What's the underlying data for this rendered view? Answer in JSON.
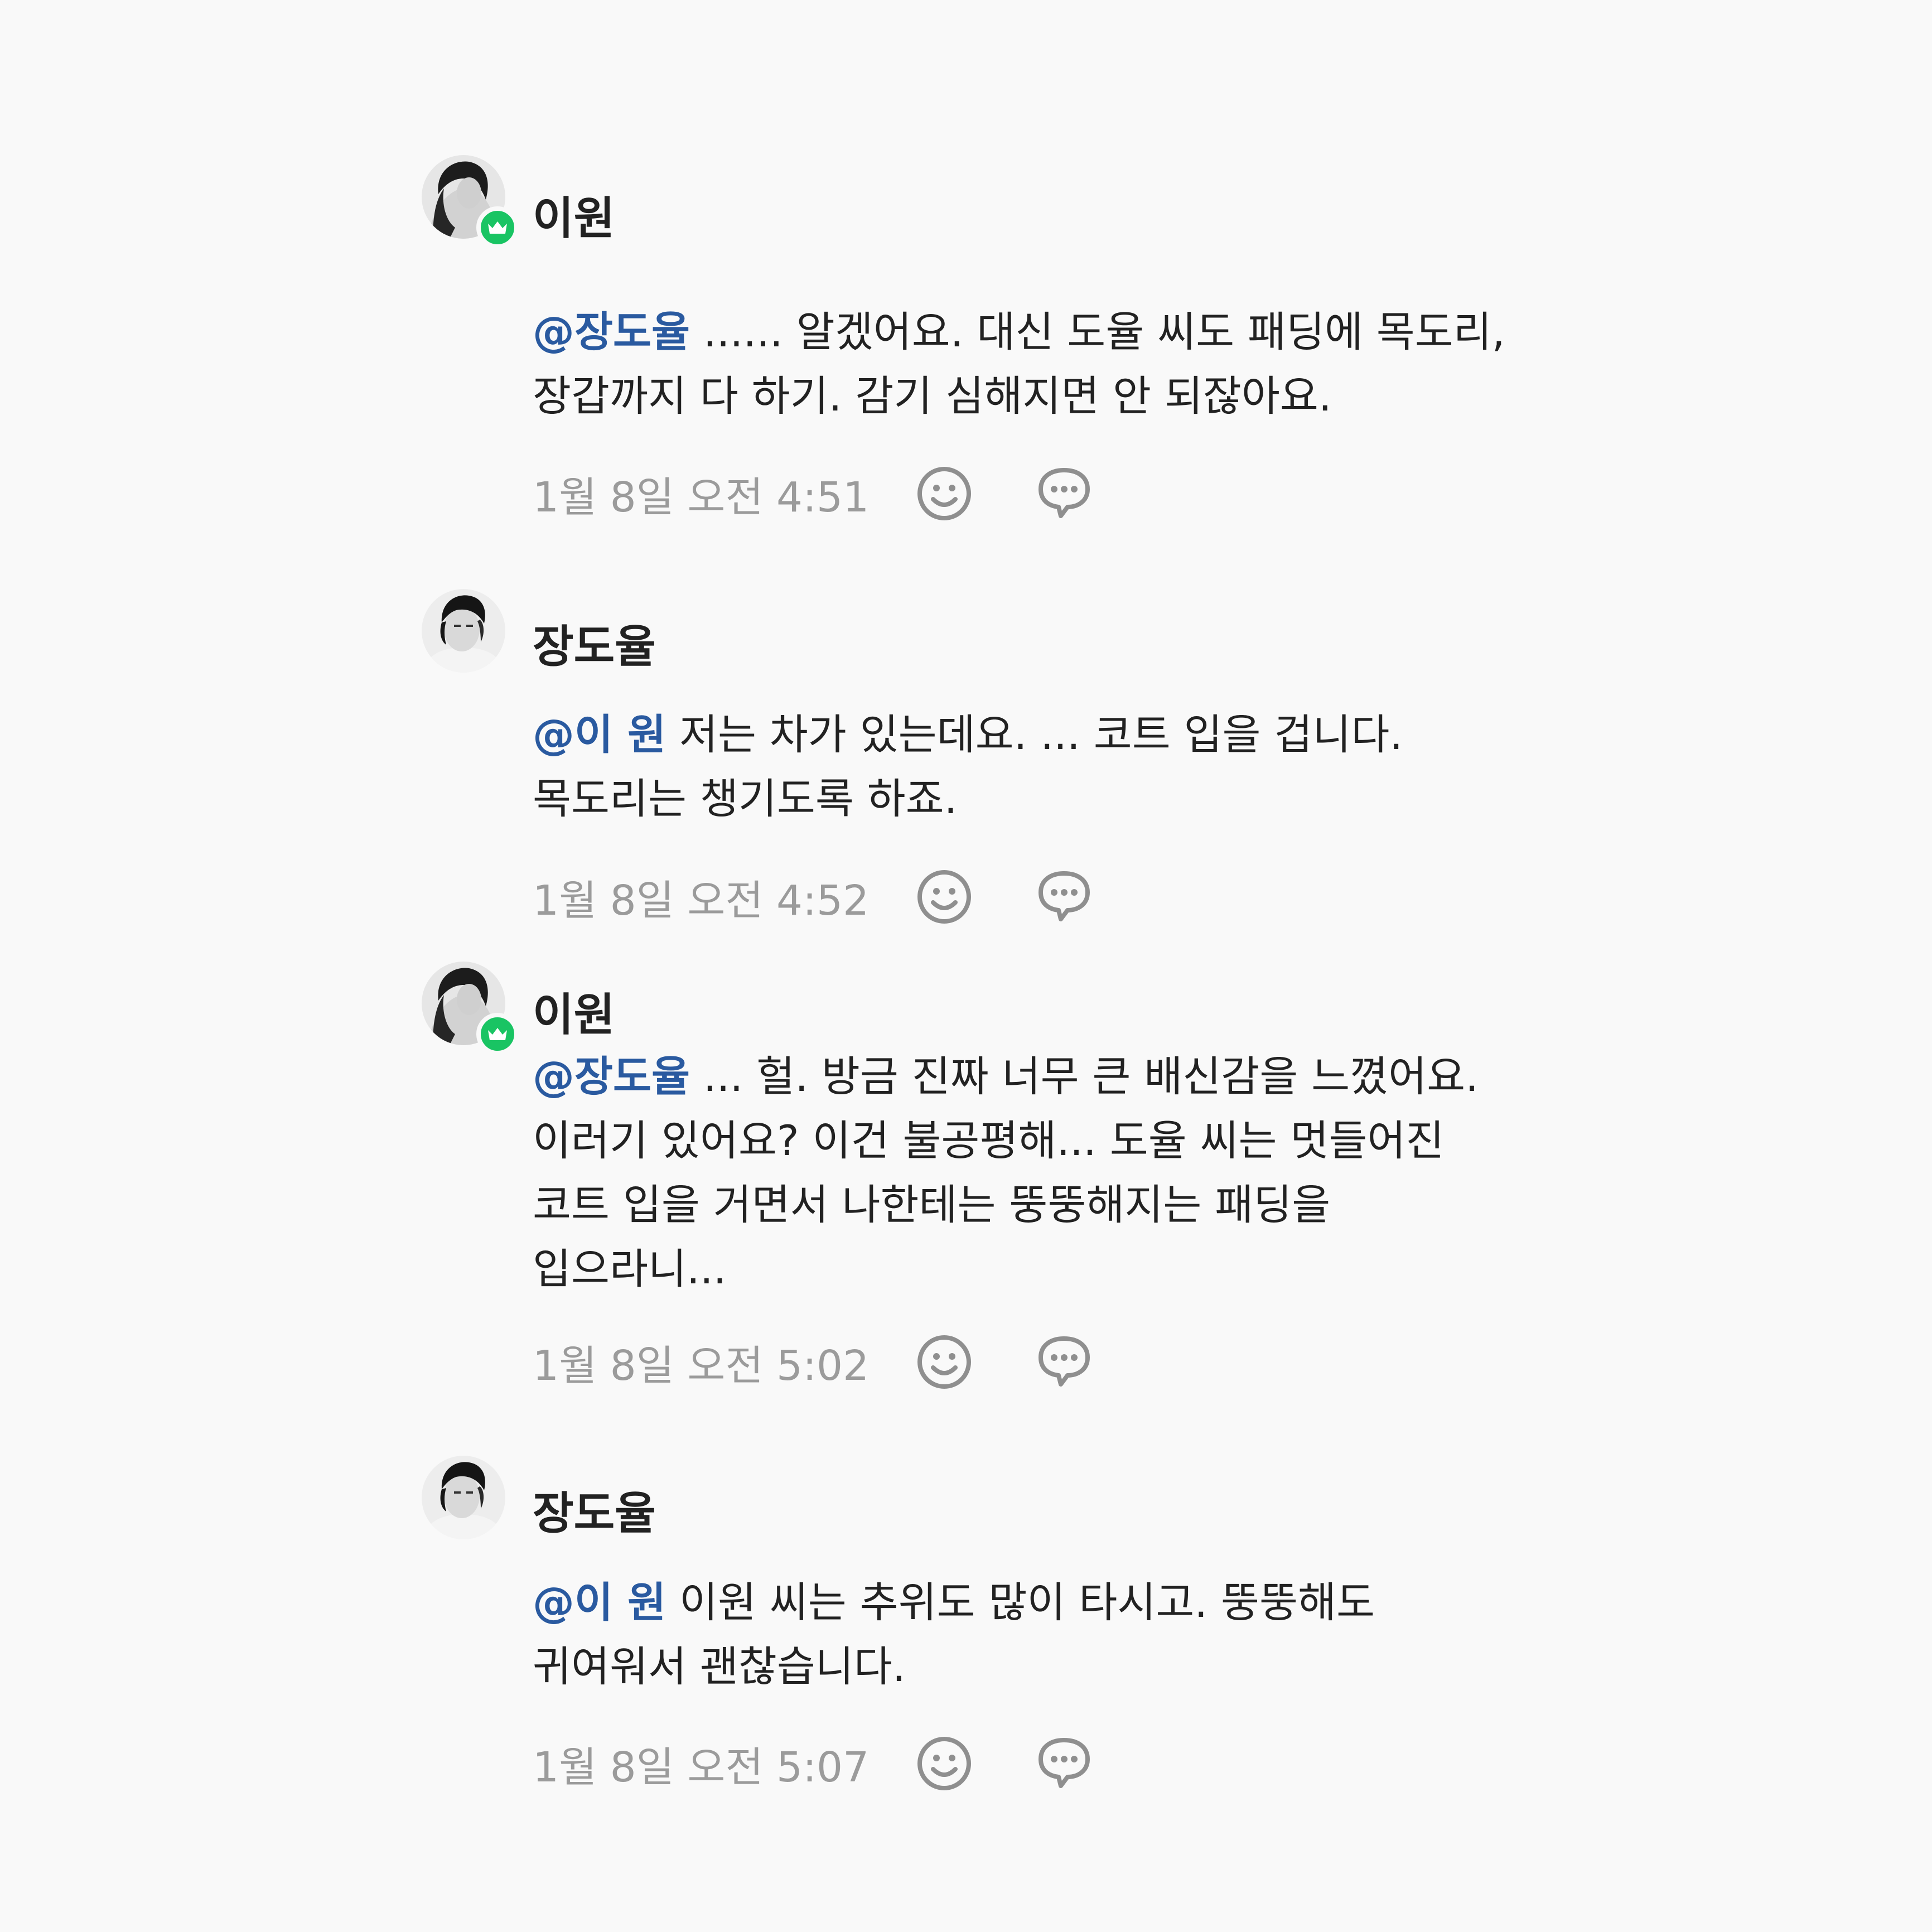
{
  "comments": [
    {
      "author": "이원",
      "host": true,
      "mention": "@장도율",
      "text": " ...... 알겠어요. 대신 도율 씨도 패딩에 목도리, 장갑까지 다 하기. 감기 심해지면 안 되잖아요.",
      "timestamp": "1월 8일 오전 4:51"
    },
    {
      "author": "장도율",
      "host": false,
      "mention": "@이 원",
      "text": " 저는 차가 있는데요. ... 코트 입을 겁니다. 목도리는 챙기도록 하죠.",
      "timestamp": "1월 8일 오전 4:52"
    },
    {
      "author": "이원",
      "host": true,
      "mention": "@장도율",
      "text": " ... 헐. 방금 진짜 너무 큰 배신감을 느꼈어요. 이러기 있어요? 이건 불공평해... 도율 씨는 멋들어진 코트 입을 거면서 나한테는 뚱뚱해지는 패딩을 입으라니...",
      "timestamp": "1월 8일 오전 5:02"
    },
    {
      "author": "장도율",
      "host": false,
      "mention": "@이 원",
      "text": " 이원 씨는 추위도 많이 타시고. 뚱뚱해도 귀여워서 괜찮습니다.",
      "timestamp": "1월 8일 오전 5:07"
    }
  ],
  "icons": {
    "emoji": "smile-icon",
    "reply": "speech-bubble-icon",
    "badge": "crown-icon"
  },
  "colors": {
    "background": "#f9f9f9",
    "mention": "#2a5aa0",
    "badge": "#19c463",
    "meta": "#9b9b9b"
  }
}
